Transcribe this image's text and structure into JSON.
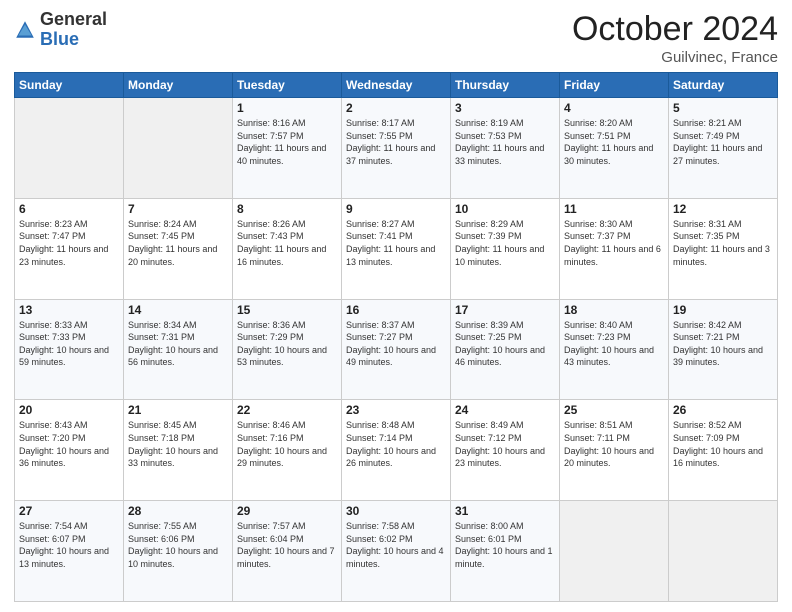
{
  "logo": {
    "general": "General",
    "blue": "Blue"
  },
  "title": {
    "month": "October 2024",
    "location": "Guilvinec, France"
  },
  "headers": [
    "Sunday",
    "Monday",
    "Tuesday",
    "Wednesday",
    "Thursday",
    "Friday",
    "Saturday"
  ],
  "weeks": [
    [
      {
        "day": "",
        "info": ""
      },
      {
        "day": "",
        "info": ""
      },
      {
        "day": "1",
        "info": "Sunrise: 8:16 AM\nSunset: 7:57 PM\nDaylight: 11 hours and 40 minutes."
      },
      {
        "day": "2",
        "info": "Sunrise: 8:17 AM\nSunset: 7:55 PM\nDaylight: 11 hours and 37 minutes."
      },
      {
        "day": "3",
        "info": "Sunrise: 8:19 AM\nSunset: 7:53 PM\nDaylight: 11 hours and 33 minutes."
      },
      {
        "day": "4",
        "info": "Sunrise: 8:20 AM\nSunset: 7:51 PM\nDaylight: 11 hours and 30 minutes."
      },
      {
        "day": "5",
        "info": "Sunrise: 8:21 AM\nSunset: 7:49 PM\nDaylight: 11 hours and 27 minutes."
      }
    ],
    [
      {
        "day": "6",
        "info": "Sunrise: 8:23 AM\nSunset: 7:47 PM\nDaylight: 11 hours and 23 minutes."
      },
      {
        "day": "7",
        "info": "Sunrise: 8:24 AM\nSunset: 7:45 PM\nDaylight: 11 hours and 20 minutes."
      },
      {
        "day": "8",
        "info": "Sunrise: 8:26 AM\nSunset: 7:43 PM\nDaylight: 11 hours and 16 minutes."
      },
      {
        "day": "9",
        "info": "Sunrise: 8:27 AM\nSunset: 7:41 PM\nDaylight: 11 hours and 13 minutes."
      },
      {
        "day": "10",
        "info": "Sunrise: 8:29 AM\nSunset: 7:39 PM\nDaylight: 11 hours and 10 minutes."
      },
      {
        "day": "11",
        "info": "Sunrise: 8:30 AM\nSunset: 7:37 PM\nDaylight: 11 hours and 6 minutes."
      },
      {
        "day": "12",
        "info": "Sunrise: 8:31 AM\nSunset: 7:35 PM\nDaylight: 11 hours and 3 minutes."
      }
    ],
    [
      {
        "day": "13",
        "info": "Sunrise: 8:33 AM\nSunset: 7:33 PM\nDaylight: 10 hours and 59 minutes."
      },
      {
        "day": "14",
        "info": "Sunrise: 8:34 AM\nSunset: 7:31 PM\nDaylight: 10 hours and 56 minutes."
      },
      {
        "day": "15",
        "info": "Sunrise: 8:36 AM\nSunset: 7:29 PM\nDaylight: 10 hours and 53 minutes."
      },
      {
        "day": "16",
        "info": "Sunrise: 8:37 AM\nSunset: 7:27 PM\nDaylight: 10 hours and 49 minutes."
      },
      {
        "day": "17",
        "info": "Sunrise: 8:39 AM\nSunset: 7:25 PM\nDaylight: 10 hours and 46 minutes."
      },
      {
        "day": "18",
        "info": "Sunrise: 8:40 AM\nSunset: 7:23 PM\nDaylight: 10 hours and 43 minutes."
      },
      {
        "day": "19",
        "info": "Sunrise: 8:42 AM\nSunset: 7:21 PM\nDaylight: 10 hours and 39 minutes."
      }
    ],
    [
      {
        "day": "20",
        "info": "Sunrise: 8:43 AM\nSunset: 7:20 PM\nDaylight: 10 hours and 36 minutes."
      },
      {
        "day": "21",
        "info": "Sunrise: 8:45 AM\nSunset: 7:18 PM\nDaylight: 10 hours and 33 minutes."
      },
      {
        "day": "22",
        "info": "Sunrise: 8:46 AM\nSunset: 7:16 PM\nDaylight: 10 hours and 29 minutes."
      },
      {
        "day": "23",
        "info": "Sunrise: 8:48 AM\nSunset: 7:14 PM\nDaylight: 10 hours and 26 minutes."
      },
      {
        "day": "24",
        "info": "Sunrise: 8:49 AM\nSunset: 7:12 PM\nDaylight: 10 hours and 23 minutes."
      },
      {
        "day": "25",
        "info": "Sunrise: 8:51 AM\nSunset: 7:11 PM\nDaylight: 10 hours and 20 minutes."
      },
      {
        "day": "26",
        "info": "Sunrise: 8:52 AM\nSunset: 7:09 PM\nDaylight: 10 hours and 16 minutes."
      }
    ],
    [
      {
        "day": "27",
        "info": "Sunrise: 7:54 AM\nSunset: 6:07 PM\nDaylight: 10 hours and 13 minutes."
      },
      {
        "day": "28",
        "info": "Sunrise: 7:55 AM\nSunset: 6:06 PM\nDaylight: 10 hours and 10 minutes."
      },
      {
        "day": "29",
        "info": "Sunrise: 7:57 AM\nSunset: 6:04 PM\nDaylight: 10 hours and 7 minutes."
      },
      {
        "day": "30",
        "info": "Sunrise: 7:58 AM\nSunset: 6:02 PM\nDaylight: 10 hours and 4 minutes."
      },
      {
        "day": "31",
        "info": "Sunrise: 8:00 AM\nSunset: 6:01 PM\nDaylight: 10 hours and 1 minute."
      },
      {
        "day": "",
        "info": ""
      },
      {
        "day": "",
        "info": ""
      }
    ]
  ]
}
